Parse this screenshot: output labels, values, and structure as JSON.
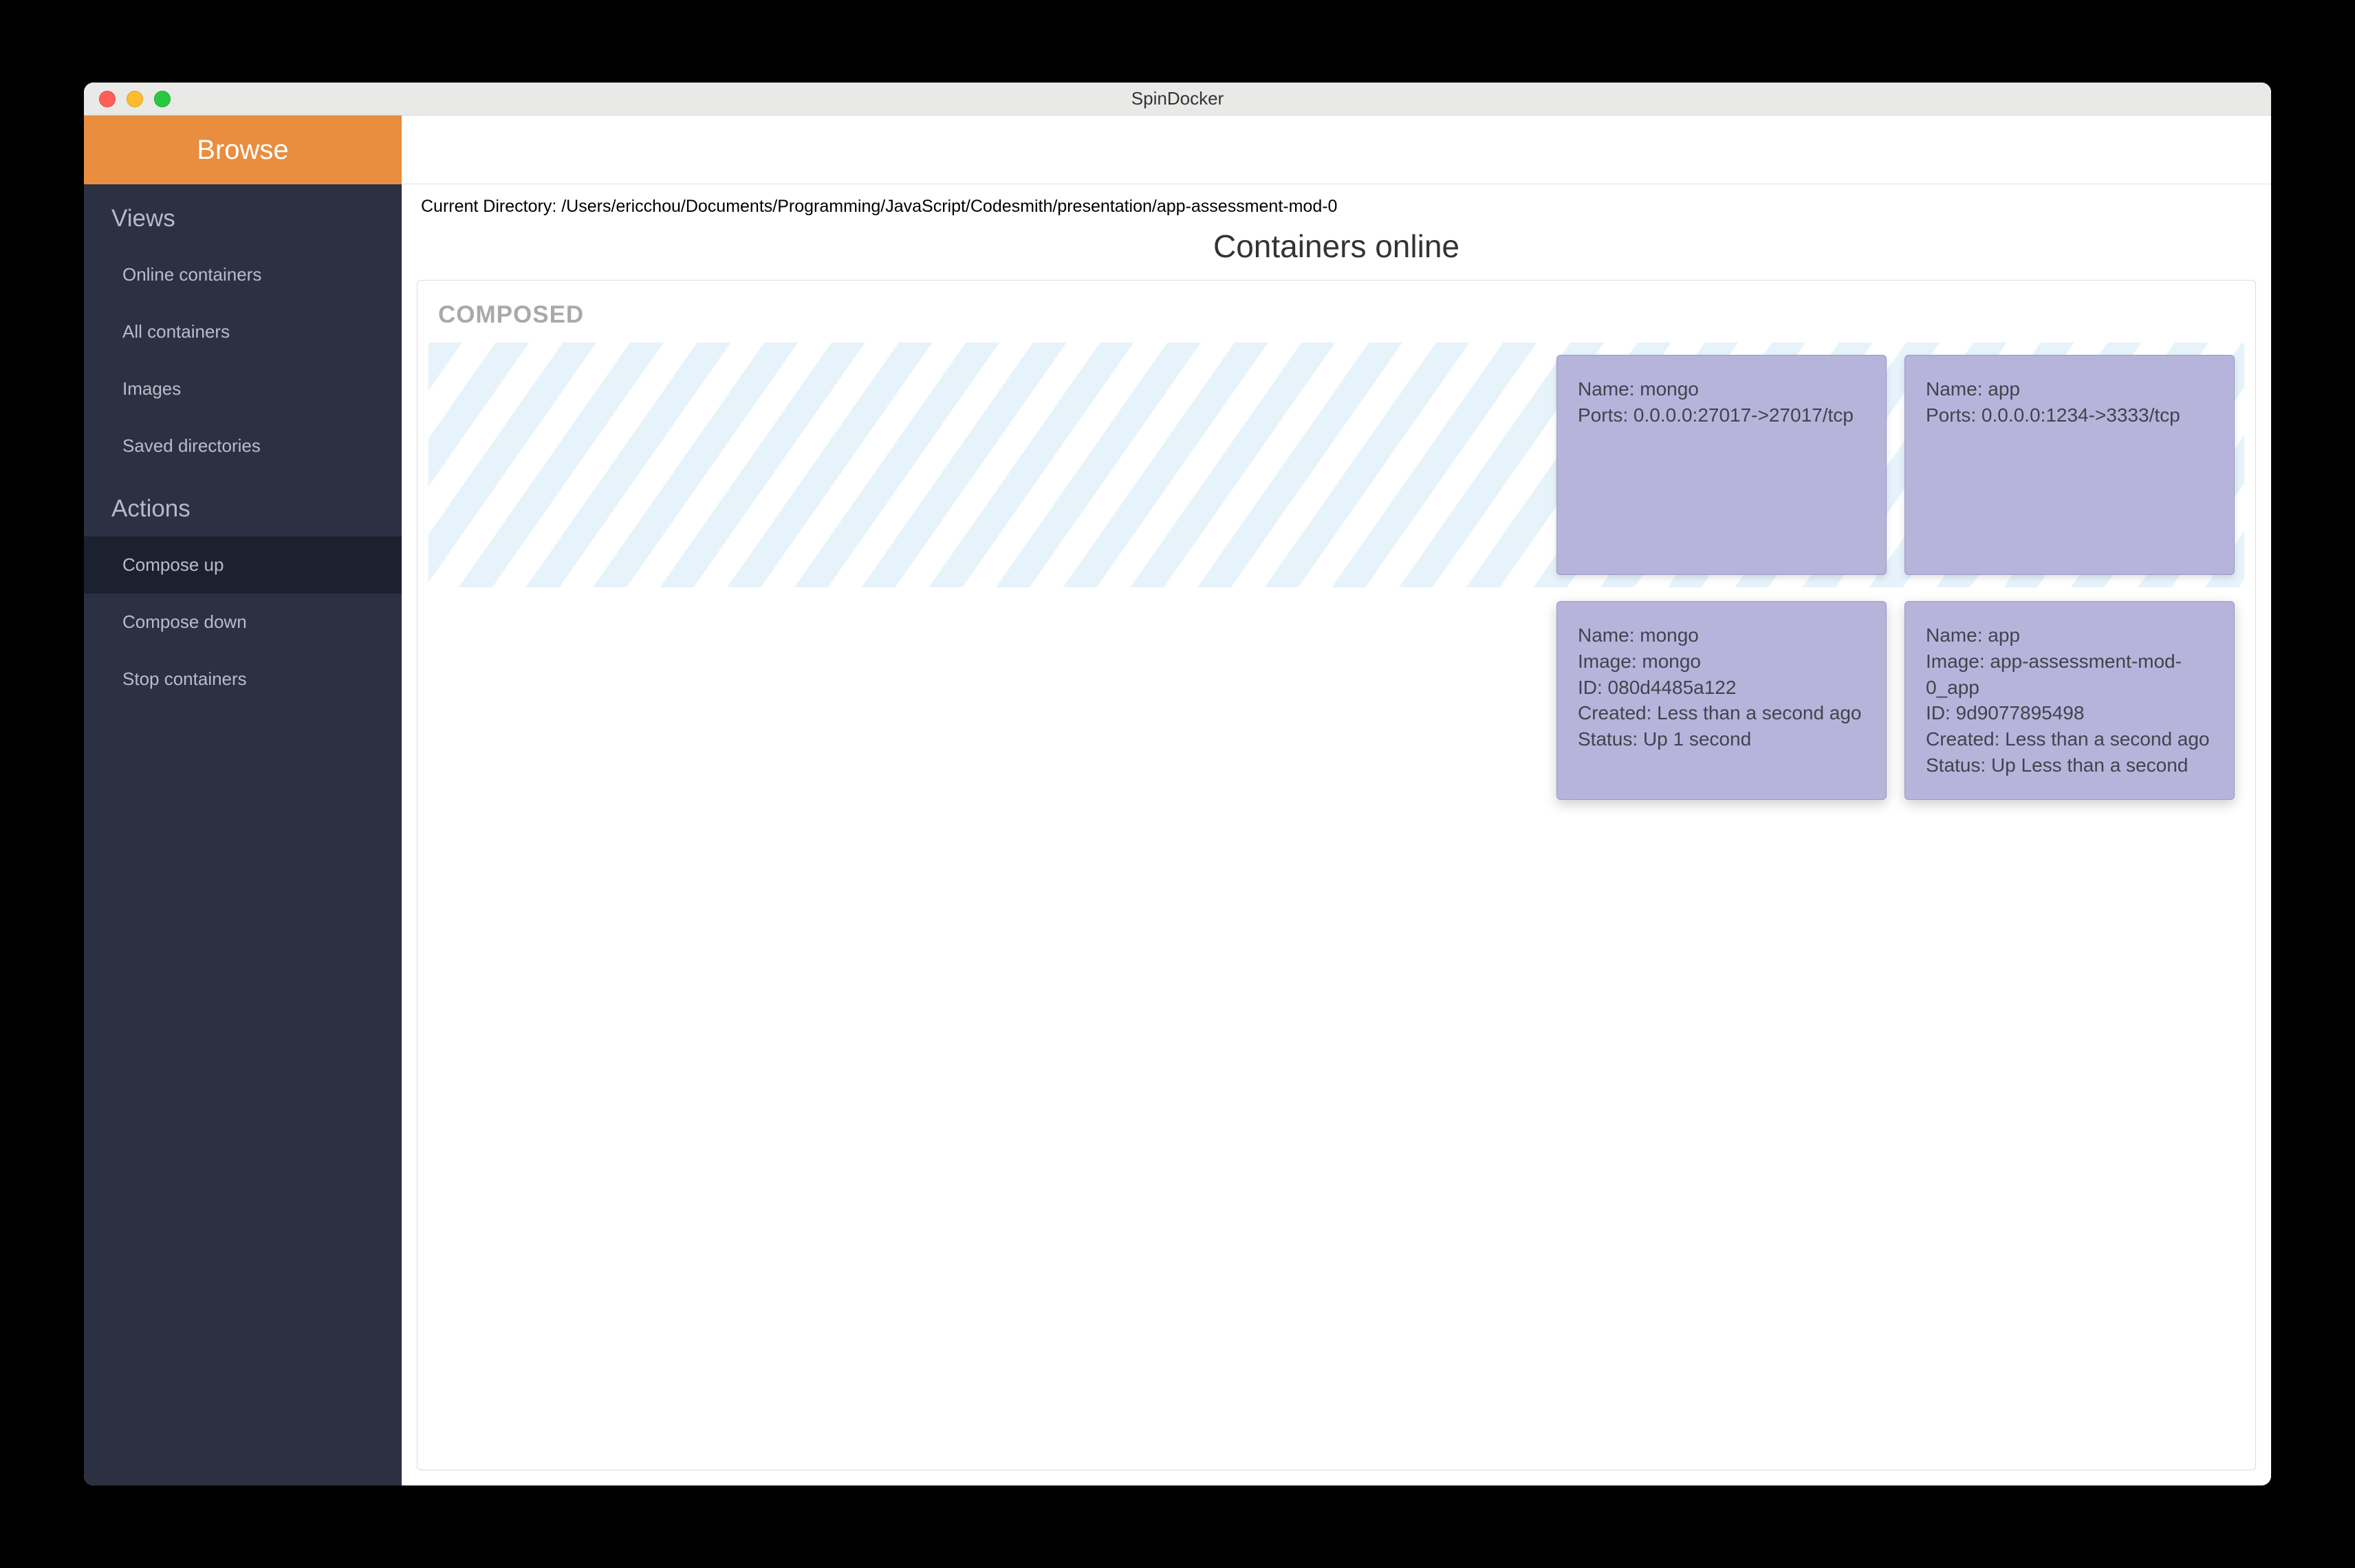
{
  "window": {
    "title": "SpinDocker"
  },
  "sidebar": {
    "header": "Browse",
    "views_section": "Views",
    "views": [
      {
        "label": "Online containers"
      },
      {
        "label": "All containers"
      },
      {
        "label": "Images"
      },
      {
        "label": "Saved directories"
      }
    ],
    "actions_section": "Actions",
    "actions": [
      {
        "label": "Compose up",
        "active": true
      },
      {
        "label": "Compose down"
      },
      {
        "label": "Stop containers"
      }
    ]
  },
  "main": {
    "current_directory_label": "Current Directory: /Users/ericchou/Documents/Programming/JavaScript/Codesmith/presentation/app-assessment-mod-0",
    "page_title": "Containers online",
    "composed_label": "COMPOSED",
    "compose_cards": [
      {
        "name_line": "Name: mongo",
        "ports_line": "Ports: 0.0.0.0:27017->27017/tcp"
      },
      {
        "name_line": "Name: app",
        "ports_line": "Ports: 0.0.0.0:1234->3333/tcp"
      }
    ],
    "detail_cards": [
      {
        "name_line": "Name: mongo",
        "image_line": "Image: mongo",
        "id_line": "ID: 080d4485a122",
        "created_line": "Created: Less than a second ago",
        "status_line": "Status: Up 1 second"
      },
      {
        "name_line": "Name: app",
        "image_line": "Image: app-assessment-mod-0_app",
        "id_line": "ID: 9d9077895498",
        "created_line": "Created: Less than a second ago",
        "status_line": "Status: Up Less than a second"
      }
    ]
  }
}
